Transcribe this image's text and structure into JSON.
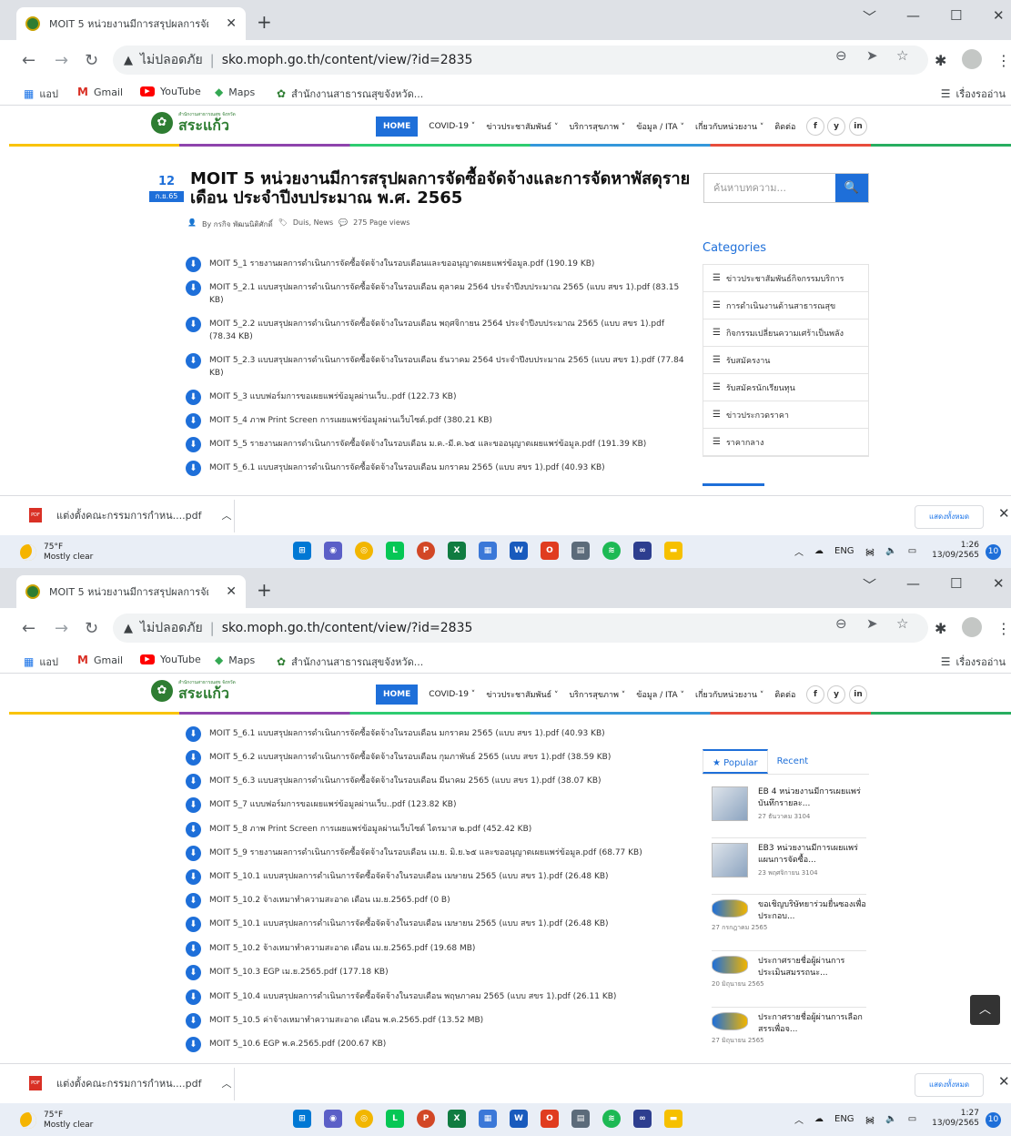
{
  "browser": {
    "tab_title": "MOIT 5 หน่วยงานมีการสรุปผลการจัดซื้อจัดจ้าง",
    "new_tab": "+",
    "insecure_label": "ไม่ปลอดภัย",
    "url": "sko.moph.go.th/content/view/?id=2835",
    "bookmarks": [
      {
        "label": "แอป"
      },
      {
        "label": "Gmail"
      },
      {
        "label": "YouTube"
      },
      {
        "label": "Maps"
      },
      {
        "label": "สำนักงานสาธารณสุขจังหวัด..."
      }
    ],
    "reading_list": "เรื่องรออ่าน"
  },
  "site": {
    "logo_small": "สำนักงานสาธารณสุข จังหวัด",
    "logo_big": "สระแก้ว",
    "menu": [
      "HOME",
      "COVID-19 ˅",
      "ข่าวประชาสัมพันธ์ ˅",
      "บริการสุขภาพ ˅",
      "ข้อมูล / ITA ˅",
      "เกี่ยวกับหน่วยงาน ˅",
      "ติดต่อ"
    ],
    "social": [
      "f",
      "y",
      "in"
    ]
  },
  "post": {
    "day": "12",
    "month": "ก.ย.65",
    "title": "MOIT 5 หน่วยงานมีการสรุปผลการจัดซื้อจัดจ้างและการจัดหาพัสดุรายเดือน ประจำปีงบประมาณ พ.ศ. 2565",
    "author": "By กรกิจ พัฒนนิติศักดิ์",
    "tags": "Duis, News",
    "views": "275 Page views"
  },
  "files_1": [
    "MOIT 5_1 รายงานผลการดำเนินการจัดซื้อจัดจ้างในรอบเดือนและขออนุญาตเผยแพร่ข้อมูล.pdf (190.19 KB)",
    "MOIT 5_2.1 แบบสรุปผลการดำเนินการจัดซื้อจัดจ้างในรอบเดือน ตุลาคม 2564 ประจำปีงบประมาณ 2565 (แบบ สขร 1).pdf (83.15 KB)",
    "MOIT 5_2.2 แบบสรุปผลการดำเนินการจัดซื้อจัดจ้างในรอบเดือน พฤศจิกายน 2564 ประจำปีงบประมาณ 2565 (แบบ สขร 1).pdf (78.34 KB)",
    "MOIT 5_2.3 แบบสรุปผลการดำเนินการจัดซื้อจัดจ้างในรอบเดือน ธันวาคม 2564 ประจำปีงบประมาณ 2565 (แบบ สขร 1).pdf (77.84 KB)",
    "MOIT 5_3 แบบฟอร์มการขอเผยแพร่ข้อมูลผ่านเว็บ..pdf (122.73 KB)",
    "MOIT 5_4 ภาพ Print Screen การเผยแพร่ข้อมูลผ่านเว็บไซต์.pdf (380.21 KB)",
    "MOIT 5_5 รายงานผลการดำเนินการจัดซื้อจัดจ้างในรอบเดือน ม.ค.-มี.ค.๖๕ และขออนุญาตเผยแพร่ข้อมูล.pdf (191.39 KB)",
    "MOIT 5_6.1 แบบสรุปผลการดำเนินการจัดซื้อจัดจ้างในรอบเดือน มกราคม 2565 (แบบ สขร 1).pdf (40.93 KB)"
  ],
  "files_2": [
    "MOIT 5_6.1 แบบสรุปผลการดำเนินการจัดซื้อจัดจ้างในรอบเดือน มกราคม 2565 (แบบ สขร 1).pdf (40.93 KB)",
    "MOIT 5_6.2 แบบสรุปผลการดำเนินการจัดซื้อจัดจ้างในรอบเดือน กุมภาพันธ์ 2565 (แบบ สขร 1).pdf (38.59 KB)",
    "MOIT 5_6.3 แบบสรุปผลการดำเนินการจัดซื้อจัดจ้างในรอบเดือน มีนาคม 2565 (แบบ สขร 1).pdf (38.07 KB)",
    "MOIT 5_7 แบบฟอร์มการขอเผยแพร่ข้อมูลผ่านเว็บ..pdf (123.82 KB)",
    "MOIT 5_8 ภาพ Print Screen การเผยแพร่ข้อมูลผ่านเว็บไซต์ ไตรมาส ๒.pdf (452.42 KB)",
    "MOIT 5_9 รายงานผลการดำเนินการจัดซื้อจัดจ้างในรอบเดือน เม.ย. มิ.ย.๖๕ และขออนุญาตเผยแพร่ข้อมูล.pdf (68.77 KB)",
    "MOIT 5_10.1 แบบสรุปผลการดำเนินการจัดซื้อจัดจ้างในรอบเดือน เมษายน 2565 (แบบ สขร 1).pdf (26.48 KB)",
    "MOIT 5_10.2 จ้างเหมาทำความสะอาด เดือน เม.ย.2565.pdf (0 B)",
    "MOIT 5_10.1 แบบสรุปผลการดำเนินการจัดซื้อจัดจ้างในรอบเดือน เมษายน 2565 (แบบ สขร 1).pdf (26.48 KB)",
    "MOIT 5_10.2 จ้างเหมาทำความสะอาด เดือน เม.ย.2565.pdf (19.68 MB)",
    "MOIT 5_10.3 EGP เม.ย.2565.pdf (177.18 KB)",
    "MOIT 5_10.4 แบบสรุปผลการดำเนินการจัดซื้อจัดจ้างในรอบเดือน พฤษภาคม 2565 (แบบ สขร 1).pdf (26.11 KB)",
    "MOIT 5_10.5 ค่าจ้างเหมาทำความสะอาด เดือน พ.ค.2565.pdf (13.52 MB)",
    "MOIT 5_10.6 EGP พ.ค.2565.pdf (200.67 KB)"
  ],
  "sidebar": {
    "search_placeholder": "ค้นหาบทความ...",
    "categories_title": "Categories",
    "categories": [
      "ข่าวประชาสัมพันธ์กิจกรรมบริการ",
      "การดำเนินงานด้านสาธารณสุข",
      "กิจกรรมเปลี่ยนความเศร้าเป็นพลัง",
      "รับสมัครงาน",
      "รับสมัครนักเรียนทุน",
      "ข่าวประกวดราคา",
      "ราคากลาง"
    ],
    "popular_tab": "Popular",
    "recent_tab": "Recent",
    "popular": [
      {
        "title": "EB 4 หน่วยงานมีการเผยแพร่บันทึกรายละ...",
        "date": "27 ธันวาคม 3104"
      },
      {
        "title": "EB3 หน่วยงานมีการเผยแพร่แผนการจัดซื้อ...",
        "date": "23 พฤศจิกายน 3104"
      },
      {
        "title": "ขอเชิญบริษัทยาร่วมยื่นซองเพื่อประกอบ...",
        "date": "27 กรกฎาคม 2565"
      },
      {
        "title": "ประกาศรายชื่อผู้ผ่านการประเมินสมรรถนะ...",
        "date": "20 มิถุนายน 2565"
      },
      {
        "title": "ประกาศรายชื่อผู้ผ่านการเลือกสรรเพื่อจ...",
        "date": "27 มิถุนายน 2565"
      }
    ]
  },
  "downloads": {
    "file": "แต่งตั้งคณะกรรมการกำหน....pdf",
    "show_all": "แสดงทั้งหมด"
  },
  "taskbar": {
    "temp": "75°F",
    "condition": "Mostly clear",
    "lang": "ENG",
    "time_1": "1:26",
    "time_2": "1:27",
    "date": "13/09/2565",
    "notifications": "10"
  },
  "colors": {
    "accent": "#1e6fd9",
    "brand_green": "#2e7d32"
  }
}
